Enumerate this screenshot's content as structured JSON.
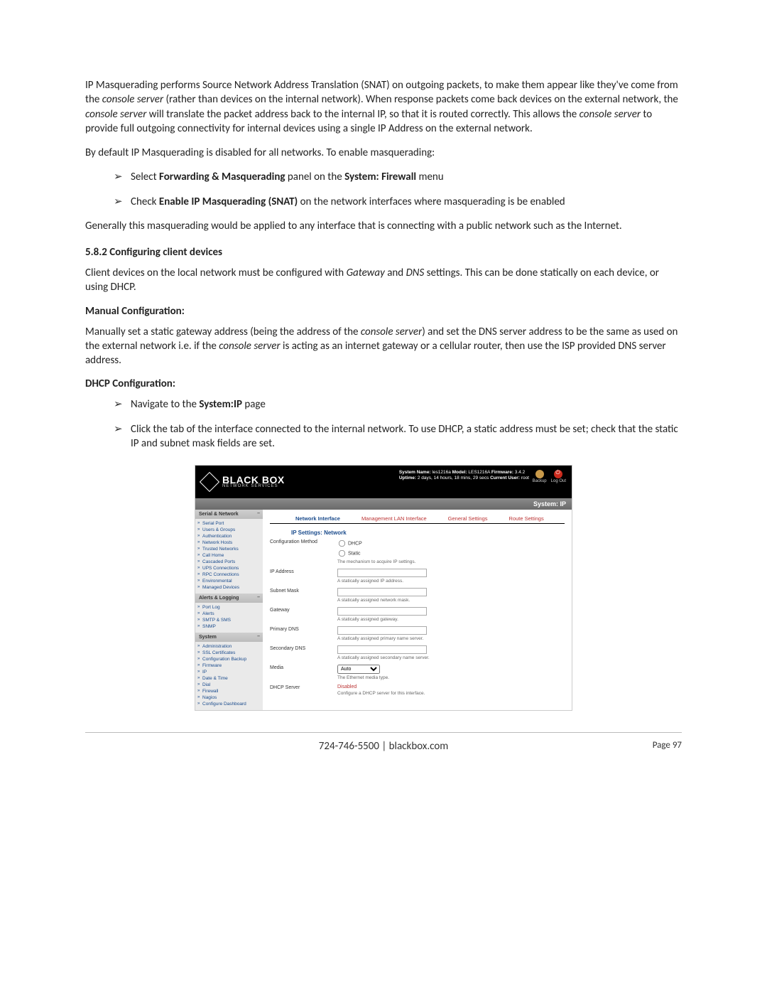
{
  "doc": {
    "p1a": "IP Masquerading performs Source Network Address Translation (SNAT) on outgoing packets, to make them appear like they've come from the ",
    "p1b": " (rather than devices on the internal network). When response packets come back devices on the external network, the ",
    "p1c": " will translate the packet address back to the internal IP, so that it is routed correctly. This allows the ",
    "p1d": " to provide full outgoing connectivity for internal devices using a single IP Address on the external network.",
    "p2": "By default IP Masquerading is disabled for all networks. To enable masquerading:",
    "b1_pre": "Select ",
    "b1_bold1": "Forwarding & Masquerading",
    "b1_mid": " panel on the ",
    "b1_bold2": "System: Firewall ",
    "b1_post": " menu",
    "b2_pre": "Check ",
    "b2_bold": "Enable IP Masquerading (SNAT)",
    "b2_post": " on the network interfaces where masquerading is be enabled",
    "p3": "Generally this masquerading would be applied to any interface that is connecting with a public network such as the Internet.",
    "h582": "5.8.2    Configuring client devices",
    "p4a": " Client devices on the local network must be configured with ",
    "p4b": " and ",
    "p4c": " settings. This can be done statically on each device, or using DHCP.",
    "manual_h": "Manual Configuration:",
    "p5a": "Manually set a static gateway address (being the address of the ",
    "p5b": ") and set the DNS server address to be the same as used on the external network i.e. if the ",
    "p5c": " is acting as an internet gateway or a cellular router, then use the ISP provided DNS server address.",
    "dhcp_h": "DHCP Configuration:",
    "b3_pre": "Navigate to the ",
    "b3_bold": "System:IP",
    "b3_post": " page",
    "b4": "Click the tab of the interface connected to the internal network. To use DHCP, a static address must be set; check that the static IP and subnet mask fields are set.",
    "console_server": "console server",
    "gateway": "Gateway",
    "dns": "DNS"
  },
  "shot": {
    "logo_main": "BLACK BOX",
    "logo_sub": "NETWORK SERVICES",
    "sys_line1_a": "System Name:",
    "sys_line1_b": " les1216a  ",
    "sys_line1_c": "Model:",
    "sys_line1_d": " LES1216A  ",
    "sys_line1_e": "Firmware:",
    "sys_line1_f": " 3.4.2",
    "sys_line2_a": "Uptime:",
    "sys_line2_b": " 2 days, 14 hours, 18 mins, 29 secs  ",
    "sys_line2_c": "Current User:",
    "sys_line2_d": " root",
    "backup": "Backup",
    "logout": "Log Out",
    "crumb": "System: IP",
    "groups": {
      "g1": "Serial & Network",
      "g2": "Alerts & Logging",
      "g3": "System"
    },
    "g1_items": [
      "Serial Port",
      "Users & Groups",
      "Authentication",
      "Network Hosts",
      "Trusted Networks",
      "Call Home",
      "Cascaded Ports",
      "UPS Connections",
      "RPC Connections",
      "Environmental",
      "Managed Devices"
    ],
    "g2_items": [
      "Port Log",
      "Alerts",
      "SMTP & SMS",
      "SNMP"
    ],
    "g3_items": [
      "Administration",
      "SSL Certificates",
      "Configuration Backup",
      "Firmware",
      "IP",
      "Date & Time",
      "Dial",
      "Firewall",
      "Nagios",
      "Configure Dashboard"
    ],
    "tabs": [
      "Network Interface",
      "Management LAN Interface",
      "General Settings",
      "Route Settings"
    ],
    "section": "IP Settings: Network",
    "rows": {
      "conf_method": "Configuration Method",
      "dhcp": "DHCP",
      "static": "Static",
      "conf_desc": "The mechanism to acquire IP settings.",
      "ip": "IP Address",
      "ip_desc": "A statically assigned IP address.",
      "mask": "Subnet Mask",
      "mask_desc": "A statically assigned network mask.",
      "gw": "Gateway",
      "gw_desc": "A statically assigned gateway.",
      "pdns": "Primary DNS",
      "pdns_desc": "A statically assigned primary name server.",
      "sdns": "Secondary DNS",
      "sdns_desc": "A statically assigned secondary name server.",
      "media": "Media",
      "media_opt": "Auto",
      "media_desc": "The Ethernet media type.",
      "dhcpsrv": "DHCP Server",
      "disabled": "Disabled",
      "dhcpsrv_desc": "Configure a DHCP server for this interface."
    }
  },
  "footer": {
    "phone_site": "724-746-5500 | blackbox.com",
    "page": "Page 97"
  }
}
